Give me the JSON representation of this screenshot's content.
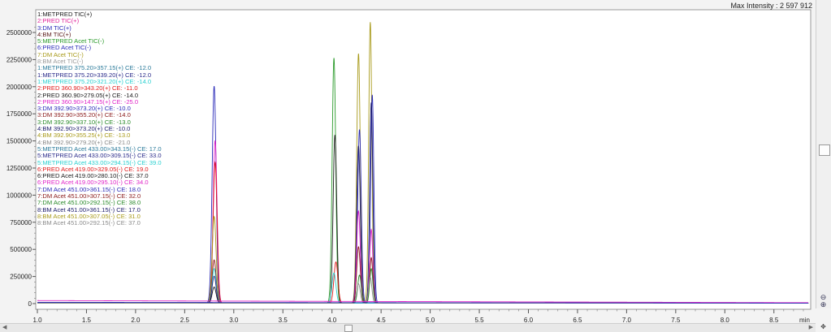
{
  "max_intensity_label": "Max Intensity : 2 597 912",
  "x_unit_label": "min",
  "zoom_in_icon": "magnifier-plus-icon",
  "zoom_out_icon": "magnifier-minus-icon",
  "legend": [
    {
      "text": "1:METPRED TIC(+)",
      "color": "#1a1a1a"
    },
    {
      "text": "2:PRED TIC(+)",
      "color": "#e0249a"
    },
    {
      "text": "3:DM TIC(+)",
      "color": "#2a2ab8"
    },
    {
      "text": "4:BM TIC(+)",
      "color": "#5a1a1a"
    },
    {
      "text": "5:METPRED Acet TIC(-)",
      "color": "#2a9a2a"
    },
    {
      "text": "6:PRED Acet TIC(-)",
      "color": "#2a2ab8"
    },
    {
      "text": "7:DM Acet TIC(-)",
      "color": "#a89a1a"
    },
    {
      "text": "8:BM Acet TIC(-)",
      "color": "#9a9a9a"
    },
    {
      "text": "1:METPRED 375.20>357.15(+) CE: -12.0",
      "color": "#2a7a9a"
    },
    {
      "text": "1:METPRED 375.20>339.20(+) CE: -12.0",
      "color": "#2a2a8a"
    },
    {
      "text": "1:METPRED 375.20>321.20(+) CE: -14.0",
      "color": "#2ad0d0"
    },
    {
      "text": "2:PRED 360.90>343.20(+) CE: -11.0",
      "color": "#e01a1a"
    },
    {
      "text": "2:PRED 360.90>279.05(+) CE: -14.0",
      "color": "#1a1a1a"
    },
    {
      "text": "2:PRED 360.90>147.15(+) CE: -25.0",
      "color": "#e024c8"
    },
    {
      "text": "3:DM 392.90>373.20(+) CE: -10.0",
      "color": "#2a2ab8"
    },
    {
      "text": "3:DM 392.90>355.20(+) CE: -14.0",
      "color": "#8a1a1a"
    },
    {
      "text": "3:DM 392.90>337.10(+) CE: -13.0",
      "color": "#2a8a2a"
    },
    {
      "text": "4:BM 392.90>373.20(+) CE: -10.0",
      "color": "#1a1a6a"
    },
    {
      "text": "4:BM 392.90>355.25(+) CE: -13.0",
      "color": "#a89a1a"
    },
    {
      "text": "4:BM 392.90>279.20(+) CE: -21.0",
      "color": "#8a8a8a"
    },
    {
      "text": "5:METPRED Acet 433.00>343.15(-) CE: 17.0",
      "color": "#2a7a9a"
    },
    {
      "text": "5:METPRED Acet 433.00>309.15(-) CE: 33.0",
      "color": "#2a2a8a"
    },
    {
      "text": "5:METPRED Acet 433.00>294.15(-) CE: 39.0",
      "color": "#2ad0d0"
    },
    {
      "text": "6:PRED Acet 419.00>329.05(-) CE: 19.0",
      "color": "#e01a1a"
    },
    {
      "text": "6:PRED Acet 419.00>280.10(-) CE: 37.0",
      "color": "#1a1a1a"
    },
    {
      "text": "6:PRED Acet 419.00>295.10(-) CE: 34.0",
      "color": "#e024c8"
    },
    {
      "text": "7:DM Acet 451.00>361.15(-) CE: 18.0",
      "color": "#2a2ab8"
    },
    {
      "text": "7:DM Acet 451.00>307.15(-) CE: 32.0",
      "color": "#8a1a1a"
    },
    {
      "text": "7:DM Acet 451.00>292.15(-) CE: 38.0",
      "color": "#2a8a2a"
    },
    {
      "text": "8:BM Acet 451.00>361.15(-) CE: 17.0",
      "color": "#1a1a6a"
    },
    {
      "text": "8:BM Acet 451.00>307.05(-) CE: 31.0",
      "color": "#a89a1a"
    },
    {
      "text": "8:BM Acet 451.00>292.15(-) CE: 37.0",
      "color": "#8a8a8a"
    }
  ],
  "chart_data": {
    "type": "line",
    "title": "",
    "xlabel": "min",
    "ylabel": "",
    "xlim": [
      1.0,
      8.8
    ],
    "ylim": [
      -30000,
      2620000
    ],
    "x_ticks": [
      1.0,
      1.5,
      2.0,
      2.5,
      3.0,
      3.5,
      4.0,
      4.5,
      5.0,
      5.5,
      6.0,
      6.5,
      7.0,
      7.5,
      8.0,
      8.5
    ],
    "x_tick_labels": [
      "1.0",
      "1.5",
      "2.0",
      "2.5",
      "3.0",
      "3.5",
      "4.0",
      "4.5",
      "5.0",
      "5.5",
      "6.0",
      "6.5",
      "7.0",
      "7.5",
      "8.0",
      "8.5"
    ],
    "y_ticks": [
      0,
      250000,
      500000,
      750000,
      1000000,
      1250000,
      1500000,
      1750000,
      2000000,
      2250000,
      2500000
    ],
    "y_tick_labels": [
      "0",
      "250000",
      "500000",
      "750000",
      "1000000",
      "1250000",
      "1500000",
      "1750000",
      "2000000",
      "2250000",
      "2500000"
    ],
    "grid": false,
    "legend_position": "top-left",
    "series": [
      {
        "color": "#2a2ab8",
        "baseline": 5000,
        "peaks": [
          [
            2.8,
            2000000,
            0.02
          ]
        ]
      },
      {
        "color": "#e024c8",
        "baseline": 4000,
        "peaks": [
          [
            2.81,
            1500000,
            0.02
          ]
        ]
      },
      {
        "color": "#e01a1a",
        "baseline": 3000,
        "peaks": [
          [
            2.81,
            1300000,
            0.02
          ]
        ]
      },
      {
        "color": "#a89a1a",
        "baseline": 3000,
        "peaks": [
          [
            2.8,
            800000,
            0.02
          ]
        ]
      },
      {
        "color": "#8a1a1a",
        "baseline": 3000,
        "peaks": [
          [
            2.8,
            400000,
            0.02
          ]
        ]
      },
      {
        "color": "#2ad0d0",
        "baseline": 3000,
        "peaks": [
          [
            2.8,
            320000,
            0.02
          ]
        ]
      },
      {
        "color": "#2a2a8a",
        "baseline": 3000,
        "peaks": [
          [
            2.8,
            250000,
            0.02
          ]
        ]
      },
      {
        "color": "#1a1a1a",
        "baseline": 3000,
        "peaks": [
          [
            2.8,
            150000,
            0.02
          ]
        ]
      },
      {
        "color": "#2a9a2a",
        "baseline": 5000,
        "peaks": [
          [
            4.02,
            2260000,
            0.018
          ]
        ]
      },
      {
        "color": "#1a1a1a",
        "baseline": 5000,
        "peaks": [
          [
            4.03,
            1550000,
            0.018
          ]
        ]
      },
      {
        "color": "#e01a1a",
        "baseline": 4000,
        "peaks": [
          [
            4.04,
            380000,
            0.02
          ]
        ]
      },
      {
        "color": "#2ad0d0",
        "baseline": 3000,
        "peaks": [
          [
            4.02,
            280000,
            0.02
          ]
        ]
      },
      {
        "color": "#a89a1a",
        "baseline": 5000,
        "peaks": [
          [
            4.27,
            2300000,
            0.018
          ],
          [
            4.39,
            2590000,
            0.016
          ]
        ]
      },
      {
        "color": "#2a2ab8",
        "baseline": 5000,
        "peaks": [
          [
            4.28,
            1600000,
            0.018
          ],
          [
            4.41,
            1920000,
            0.016
          ]
        ]
      },
      {
        "color": "#1a1a6a",
        "baseline": 4000,
        "peaks": [
          [
            4.27,
            1450000,
            0.018
          ],
          [
            4.4,
            1850000,
            0.016
          ]
        ]
      },
      {
        "color": "#e024c8",
        "baseline": 4000,
        "peaks": [
          [
            4.27,
            850000,
            0.018
          ],
          [
            4.4,
            680000,
            0.016
          ]
        ]
      },
      {
        "color": "#8a1a1a",
        "baseline": 4000,
        "peaks": [
          [
            4.27,
            520000,
            0.018
          ],
          [
            4.4,
            420000,
            0.016
          ]
        ]
      },
      {
        "color": "#2a8a2a",
        "baseline": 3000,
        "peaks": [
          [
            4.28,
            260000,
            0.018
          ],
          [
            4.4,
            320000,
            0.016
          ]
        ]
      },
      {
        "color": "#8a8a8a",
        "baseline": 3000,
        "peaks": [
          [
            4.27,
            180000,
            0.018
          ],
          [
            4.39,
            240000,
            0.016
          ]
        ]
      },
      {
        "color": "#e024c8",
        "baseline": 28000,
        "slope": -2500,
        "peaks": []
      },
      {
        "color": "#2a2ab8",
        "baseline": 12000,
        "slope": -1000,
        "peaks": []
      }
    ]
  }
}
